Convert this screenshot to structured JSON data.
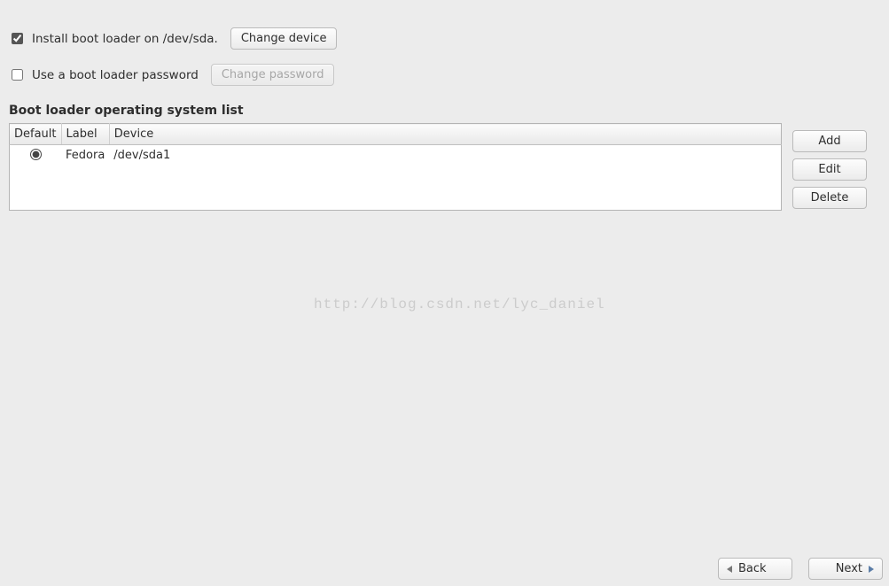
{
  "install_boot_loader": {
    "label": "Install boot loader on /dev/sda.",
    "checked": true,
    "change_device_label": "Change device"
  },
  "boot_loader_password": {
    "label": "Use a boot loader password",
    "checked": false,
    "change_password_label": "Change password"
  },
  "section_title": "Boot loader operating system list",
  "table": {
    "headers": {
      "default": "Default",
      "label": "Label",
      "device": "Device"
    },
    "rows": [
      {
        "default": true,
        "label": "Fedora",
        "device": "/dev/sda1"
      }
    ]
  },
  "side_buttons": {
    "add": "Add",
    "edit": "Edit",
    "delete": "Delete"
  },
  "watermark": "http://blog.csdn.net/lyc_daniel",
  "footer": {
    "back": "Back",
    "next": "Next"
  }
}
